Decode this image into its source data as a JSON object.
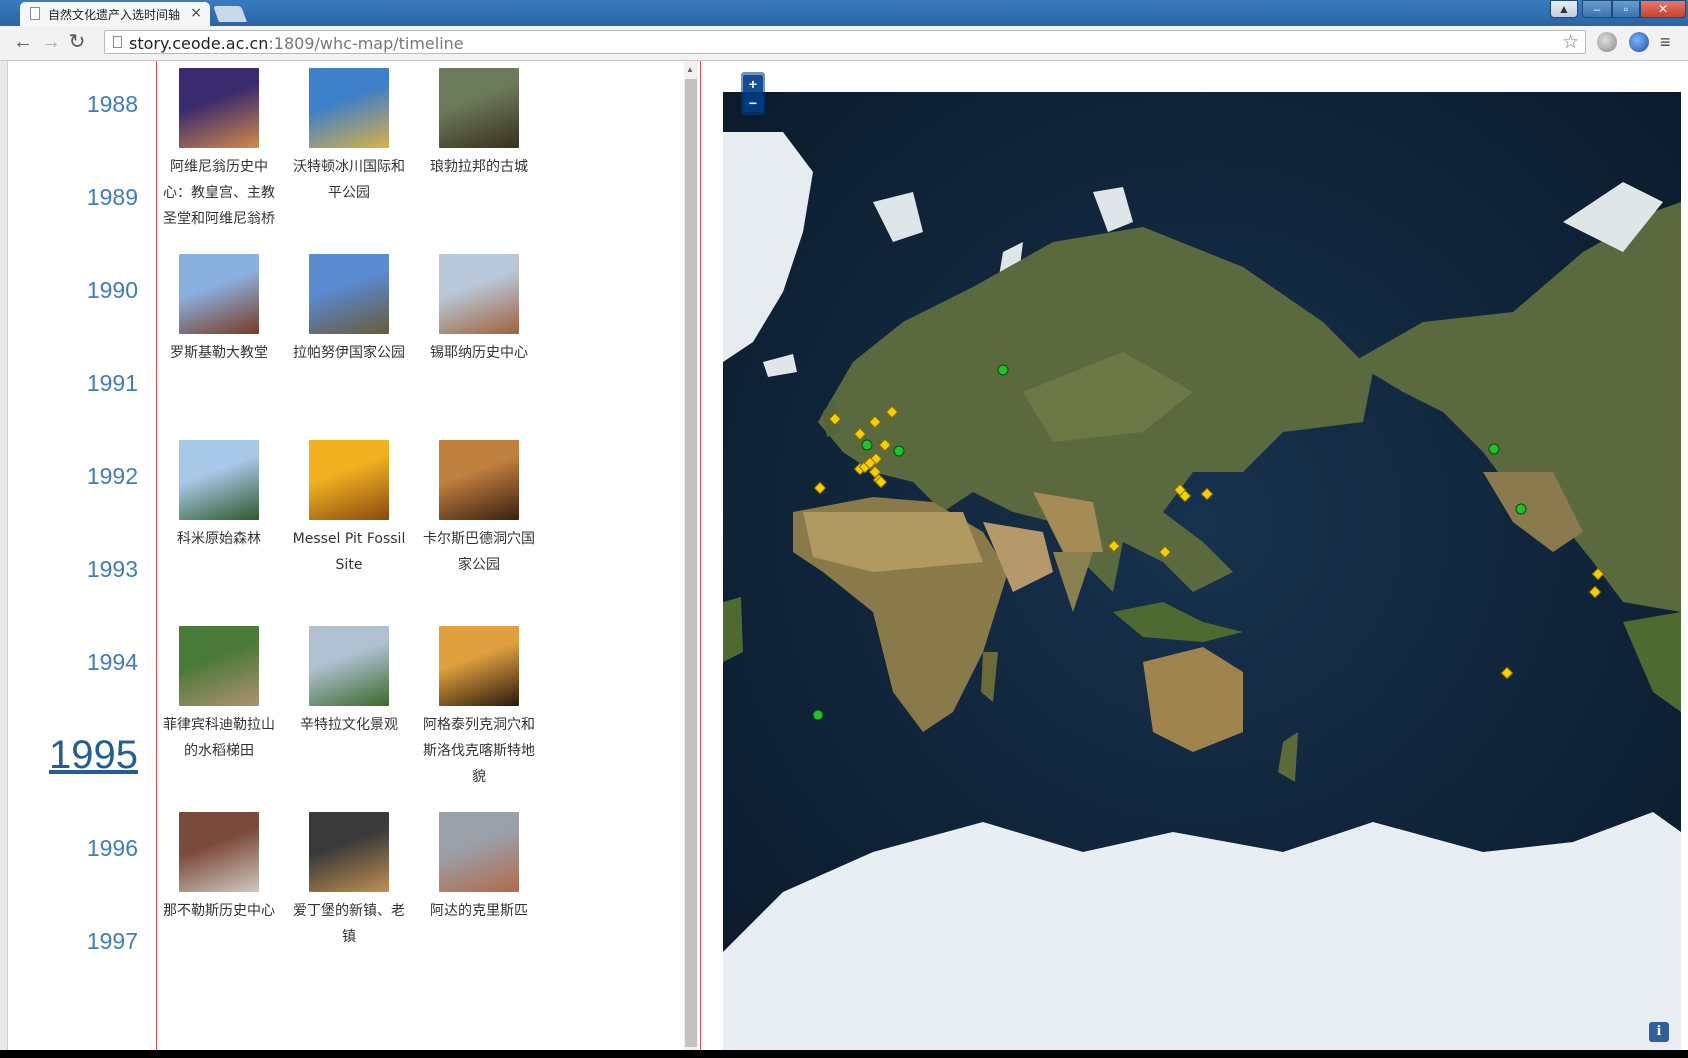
{
  "browser": {
    "tab_title": "自然文化遗产入选时间轴",
    "tab_close": "×",
    "url_host": "story.ceode.ac.cn",
    "url_path": ":1809/whc-map/timeline",
    "nav_back": "←",
    "nav_forward": "→",
    "nav_reload": "↻",
    "star": "☆",
    "menu": "≡"
  },
  "timeline": {
    "years": [
      "1988",
      "1989",
      "1990",
      "1991",
      "1992",
      "1993",
      "1994",
      "1995",
      "1996",
      "1997"
    ],
    "selected_year": "1995"
  },
  "sites": [
    {
      "name": "阿维尼翁历史中心：教皇宫、主教圣堂和阿维尼翁桥",
      "thumb": [
        "#3a2b6e",
        "#d28a4a"
      ]
    },
    {
      "name": "沃特顿冰川国际和平公园",
      "thumb": [
        "#3d7fc8",
        "#d9b04a"
      ]
    },
    {
      "name": "琅勃拉邦的古城",
      "thumb": [
        "#6a7a5a",
        "#3b2f1e"
      ]
    },
    {
      "name": "罗斯基勒大教堂",
      "thumb": [
        "#8ab0e0",
        "#7a3a22"
      ]
    },
    {
      "name": "拉帕努伊国家公园",
      "thumb": [
        "#5a8ad0",
        "#6a5a3a"
      ]
    },
    {
      "name": "锡耶纳历史中心",
      "thumb": [
        "#b8c8d8",
        "#a0603a"
      ]
    },
    {
      "name": "科米原始森林",
      "thumb": [
        "#a8c8e8",
        "#2f5a2a"
      ]
    },
    {
      "name": "Messel Pit Fossil Site",
      "thumb": [
        "#f0b020",
        "#8a4a10"
      ]
    },
    {
      "name": "卡尔斯巴德洞穴国家公园",
      "thumb": [
        "#c08040",
        "#3a2010"
      ]
    },
    {
      "name": "菲律宾科迪勒拉山的水稻梯田",
      "thumb": [
        "#4a7a3a",
        "#b09070"
      ]
    },
    {
      "name": "辛特拉文化景观",
      "thumb": [
        "#b0c0d0",
        "#3a6a2a"
      ]
    },
    {
      "name": "阿格泰列克洞穴和斯洛伐克喀斯特地貌",
      "thumb": [
        "#e0a040",
        "#2a1a0a"
      ]
    },
    {
      "name": "那不勒斯历史中心",
      "thumb": [
        "#7a4a3a",
        "#d0c8c0"
      ]
    },
    {
      "name": "爱丁堡的新镇、老镇",
      "thumb": [
        "#3a3a3a",
        "#c09050"
      ]
    },
    {
      "name": "阿达的克里斯匹",
      "thumb": [
        "#9aa0a8",
        "#b06a4a"
      ]
    }
  ],
  "map": {
    "zoom_in": "+",
    "zoom_out": "−",
    "info": "i",
    "colors": {
      "natural": "#22c02a",
      "cultural": "#f5d000"
    }
  }
}
